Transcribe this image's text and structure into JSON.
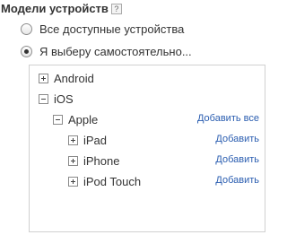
{
  "header": {
    "title": "Модели устройств",
    "help_glyph": "?"
  },
  "options": [
    {
      "label": "Все доступные устройства",
      "checked": false
    },
    {
      "label": "Я выберу самостоятельно...",
      "checked": true
    }
  ],
  "tree": {
    "nodes": [
      {
        "label": "Android",
        "expanded": false
      },
      {
        "label": "iOS",
        "expanded": true
      },
      {
        "label": "Apple",
        "expanded": true,
        "action": "Добавить все"
      },
      {
        "label": "iPad",
        "expanded": false,
        "action": "Добавить"
      },
      {
        "label": "iPhone",
        "expanded": false,
        "action": "Добавить"
      },
      {
        "label": "iPod Touch",
        "expanded": false,
        "action": "Добавить"
      }
    ]
  }
}
